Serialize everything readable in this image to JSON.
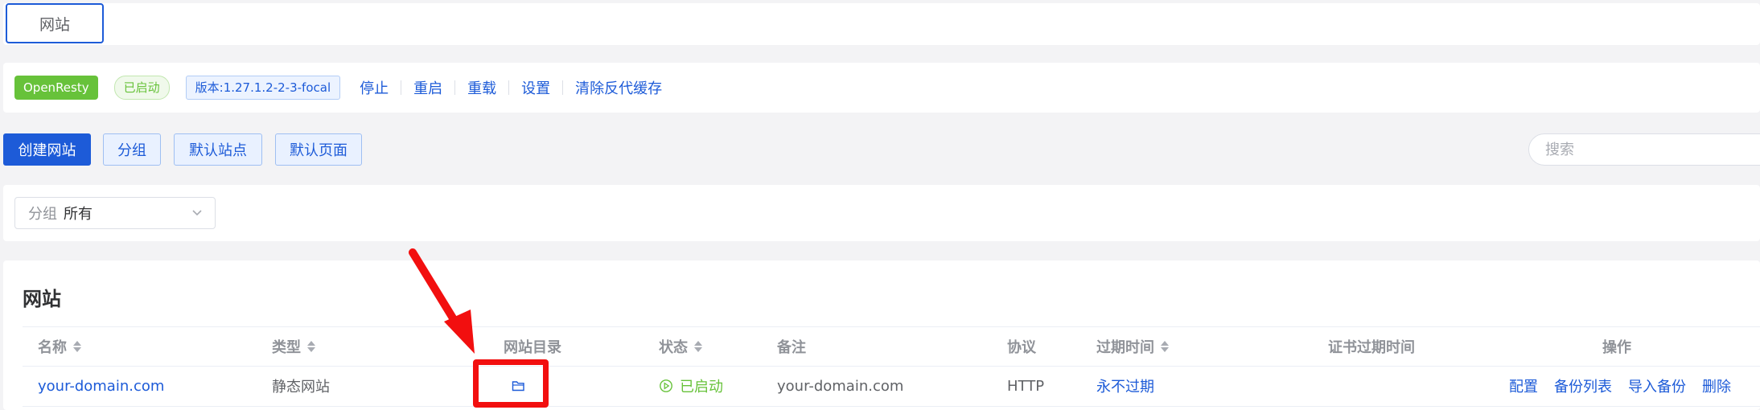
{
  "tabs": [
    {
      "label": "网站"
    }
  ],
  "status_bar": {
    "server_name": "OpenResty",
    "running_status": "已启动",
    "version": "版本:1.27.1.2-2-3-focal",
    "actions": [
      "停止",
      "重启",
      "重载",
      "设置",
      "清除反代缓存"
    ]
  },
  "toolbar": {
    "create_label": "创建网站",
    "group_label": "分组",
    "default_site_label": "默认站点",
    "default_page_label": "默认页面",
    "search_placeholder": "搜索"
  },
  "filter": {
    "group_prefix": "分组",
    "group_value": "所有"
  },
  "section_title": "网站",
  "table": {
    "columns": [
      "名称",
      "类型",
      "网站目录",
      "状态",
      "备注",
      "协议",
      "过期时间",
      "证书过期时间",
      "操作"
    ],
    "rows": [
      {
        "name": "your-domain.com",
        "type": "静态网站",
        "status": "已启动",
        "remark": "your-domain.com",
        "protocol": "HTTP",
        "expire": "永不过期",
        "cert_expire": "",
        "ops": [
          "配置",
          "备份列表",
          "导入备份",
          "删除"
        ]
      }
    ]
  },
  "colors": {
    "primary": "#1d5bd8",
    "success": "#67c23a",
    "annotation": "#f20f0f"
  }
}
